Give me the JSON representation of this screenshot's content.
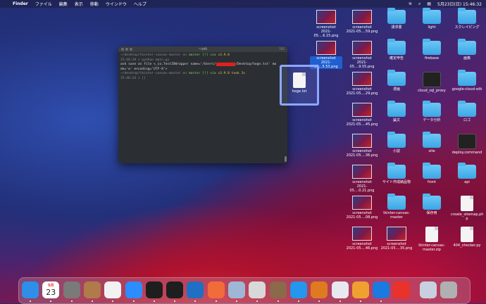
{
  "menubar": {
    "app_name": "Finder",
    "items": [
      "ファイル",
      "編集",
      "表示",
      "移動",
      "ウインドウ",
      "ヘルプ"
    ],
    "datetime": "5月23日(日)  15:46:32"
  },
  "terminal": {
    "title": "~zsh",
    "size": "7X1",
    "lines": {
      "l1a": "~/desktop/tkinter-canvas-master on ",
      "l1b": "master [!] via ",
      "l1c": "v3.9.0",
      "l2": "15:46:19 > python main.py",
      "l3a": "ask save as file <_io.TextIOWrapper name='/Users/",
      "l3b": "XXXXXXXXXX",
      "l3c": "/Desktop/hoge.txt' mo",
      "l4": "de='w' encoding='UTF-8'>",
      "l5a": "~/desktop/tkinter-canvas-master on ",
      "l5b": "master [!] via ",
      "l5c": "v3.9.0 took 3s",
      "l6": "15:46:24 > []"
    }
  },
  "drag_file": {
    "name": "hoge.txt",
    "type": "TXT"
  },
  "desktop_icons": [
    {
      "id": "c1r1",
      "label": "screenshot\n2021-05....6.15.png",
      "kind": "thumb"
    },
    {
      "id": "c1r2",
      "label": "screenshot\n2021-05...5.53.png",
      "kind": "thumb",
      "selected": true
    },
    {
      "id": "c2r1",
      "label": "screenshot\n2021-05....59.png",
      "kind": "thumb"
    },
    {
      "id": "c2r2",
      "label": "screenshot\n2021-05....9.55.png",
      "kind": "thumb"
    },
    {
      "id": "c2r3",
      "label": "screenshot\n2021-05....29.png",
      "kind": "thumb"
    },
    {
      "id": "c2r4",
      "label": "screenshot\n2021-05....45.png",
      "kind": "thumb"
    },
    {
      "id": "c2r5",
      "label": "screenshot\n2021-05....36.png",
      "kind": "thumb"
    },
    {
      "id": "c2r6",
      "label": "screenshot\n2021-05....0.21.png",
      "kind": "thumb"
    },
    {
      "id": "c2r7",
      "label": "screenshot\n2021-05....08.png",
      "kind": "thumb"
    },
    {
      "id": "c2r8",
      "label": "screenshot\n2021-05....46.png",
      "kind": "thumb"
    },
    {
      "id": "c3r1",
      "label": "請求書",
      "kind": "folder"
    },
    {
      "id": "c3r2",
      "label": "確定申告",
      "kind": "folder"
    },
    {
      "id": "c3r3",
      "label": "漫画",
      "kind": "folder"
    },
    {
      "id": "c3r4",
      "label": "論文",
      "kind": "folder"
    },
    {
      "id": "c3r5",
      "label": "小説",
      "kind": "folder"
    },
    {
      "id": "c3r6",
      "label": "サイト作成納品物",
      "kind": "folder"
    },
    {
      "id": "c3r7",
      "label": "tkinter-canvas-\nmaster",
      "kind": "folder"
    },
    {
      "id": "c3r8",
      "label": "screenshot\n2021-05....35.png",
      "kind": "thumb"
    },
    {
      "id": "c4r1",
      "label": "light",
      "kind": "folder"
    },
    {
      "id": "c4r2",
      "label": "firebase",
      "kind": "folder"
    },
    {
      "id": "c4r3",
      "label": "cloud_sql_proxy",
      "kind": "term"
    },
    {
      "id": "c4r4",
      "label": "データ分析",
      "kind": "folder"
    },
    {
      "id": "c4r5",
      "label": "site",
      "kind": "folder"
    },
    {
      "id": "c4r6",
      "label": "front",
      "kind": "folder"
    },
    {
      "id": "c4r7",
      "label": "保存用",
      "kind": "folder"
    },
    {
      "id": "c4r8",
      "label": "tkinter-canvas-\nmaster.zip",
      "kind": "doc"
    },
    {
      "id": "c5r1",
      "label": "スクレイピング",
      "kind": "folder"
    },
    {
      "id": "c5r2",
      "label": "画像",
      "kind": "folder"
    },
    {
      "id": "c5r3",
      "label": "google-cloud-sdk",
      "kind": "folder"
    },
    {
      "id": "c5r4",
      "label": "ロゴ",
      "kind": "folder"
    },
    {
      "id": "c5r5",
      "label": "deploy.command",
      "kind": "term"
    },
    {
      "id": "c5r6",
      "label": "api",
      "kind": "folder"
    },
    {
      "id": "c5r7",
      "label": "create_sitemap.ph\np",
      "kind": "doc"
    },
    {
      "id": "c5r8",
      "label": "404_checker.py",
      "kind": "doc"
    }
  ],
  "dock": {
    "calendar_day": "23",
    "calendar_month": "5月",
    "apps": [
      {
        "name": "Finder",
        "color": "#2f8fe8"
      },
      {
        "name": "Calendar",
        "color": "#ffffff"
      },
      {
        "name": "System Preferences",
        "color": "#7a7a7a"
      },
      {
        "name": "Contacts",
        "color": "#b07a4a"
      },
      {
        "name": "Chrome",
        "color": "#f2f2f2"
      },
      {
        "name": "Zoom",
        "color": "#2d8cff"
      },
      {
        "name": "Terminal 1",
        "color": "#1e1e1e"
      },
      {
        "name": "Terminal 2",
        "color": "#1e1e1e"
      },
      {
        "name": "VS Code",
        "color": "#1f6fc2"
      },
      {
        "name": "Postman",
        "color": "#f26b3a"
      },
      {
        "name": "QuickTime",
        "color": "#9fb7d6"
      },
      {
        "name": "Sequel",
        "color": "#d8d8d8"
      },
      {
        "name": "Preview",
        "color": "#8a6a4a"
      },
      {
        "name": "Docker",
        "color": "#2496ed"
      },
      {
        "name": "Sourcetree",
        "color": "#e07a20"
      },
      {
        "name": "App",
        "color": "#e8e8f0"
      },
      {
        "name": "Slides",
        "color": "#f0a030"
      },
      {
        "name": "Infinity",
        "color": "#1a7ae0"
      },
      {
        "name": "Clock",
        "color": "#e8322a"
      },
      {
        "name": "Screenshot",
        "color": "#c8d0e0"
      },
      {
        "name": "Trash",
        "color": "#b0b0b0"
      }
    ]
  }
}
